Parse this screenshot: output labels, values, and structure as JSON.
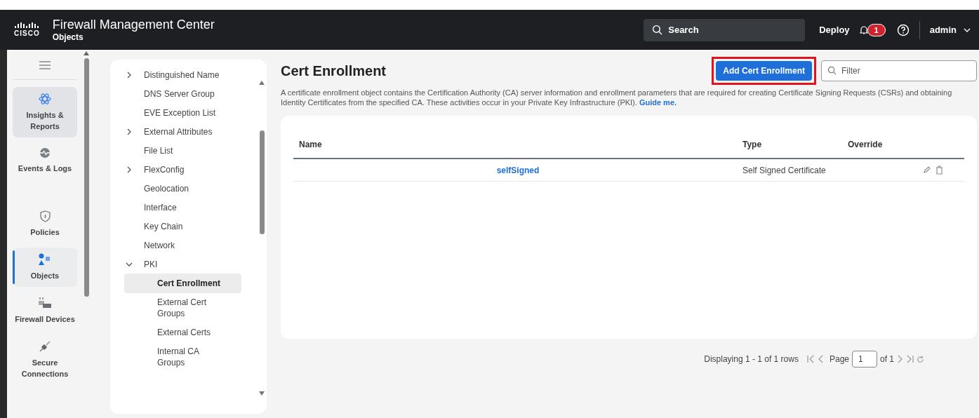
{
  "header": {
    "logo": "CISCO",
    "title": "Firewall Management Center",
    "subtitle": "Objects",
    "search_placeholder": "Search",
    "deploy": "Deploy",
    "notification_count": "1",
    "user": "admin"
  },
  "nav": [
    {
      "label": "Insights & Reports",
      "selected": false,
      "hovered": true
    },
    {
      "label": "Events & Logs",
      "selected": false,
      "hovered": false
    },
    {
      "label": "Policies",
      "selected": false,
      "hovered": false
    },
    {
      "label": "Objects",
      "selected": true,
      "hovered": false
    },
    {
      "label": "Firewall Devices",
      "selected": false,
      "hovered": false
    },
    {
      "label": "Secure Connections",
      "selected": false,
      "hovered": false
    }
  ],
  "tree": [
    {
      "label": "Distinguished Name",
      "kind": "group",
      "expanded": false,
      "selected": false
    },
    {
      "label": "DNS Server Group",
      "kind": "leaf",
      "selected": false
    },
    {
      "label": "EVE Exception List",
      "kind": "leaf",
      "selected": false
    },
    {
      "label": "External Attributes",
      "kind": "group",
      "expanded": false,
      "selected": false
    },
    {
      "label": "File List",
      "kind": "leaf",
      "selected": false
    },
    {
      "label": "FlexConfig",
      "kind": "group",
      "expanded": false,
      "selected": false
    },
    {
      "label": "Geolocation",
      "kind": "leaf",
      "selected": false
    },
    {
      "label": "Interface",
      "kind": "leaf",
      "selected": false
    },
    {
      "label": "Key Chain",
      "kind": "leaf",
      "selected": false
    },
    {
      "label": "Network",
      "kind": "leaf",
      "selected": false
    },
    {
      "label": "PKI",
      "kind": "group",
      "expanded": true,
      "selected": false,
      "children": [
        {
          "label": "Cert Enrollment",
          "selected": true
        },
        {
          "label": "External Cert Groups",
          "selected": false
        },
        {
          "label": "External Certs",
          "selected": false
        },
        {
          "label": "Internal CA Groups",
          "selected": false
        }
      ]
    }
  ],
  "page": {
    "title": "Cert Enrollment",
    "add_button": "Add Cert Enrollment",
    "add_button_highlighted": true,
    "filter_placeholder": "Filter",
    "description": "A certificate enrollment object contains the Certification Authority (CA) server information and enrollment parameters that are required for creating Certificate Signing Requests (CSRs) and obtaining Identity Certificates from the specified CA. These activities occur in your Private Key Infrastructure (PKI).",
    "guide_link": "Guide me."
  },
  "table": {
    "columns": [
      "Name",
      "Type",
      "Override"
    ],
    "rows": [
      {
        "name": "selfSigned",
        "type": "Self Signed Certificate"
      }
    ]
  },
  "pagination": {
    "summary": "Displaying 1 - 1 of 1 rows",
    "page_label": "Page",
    "page": "1",
    "of": "of 1"
  }
}
